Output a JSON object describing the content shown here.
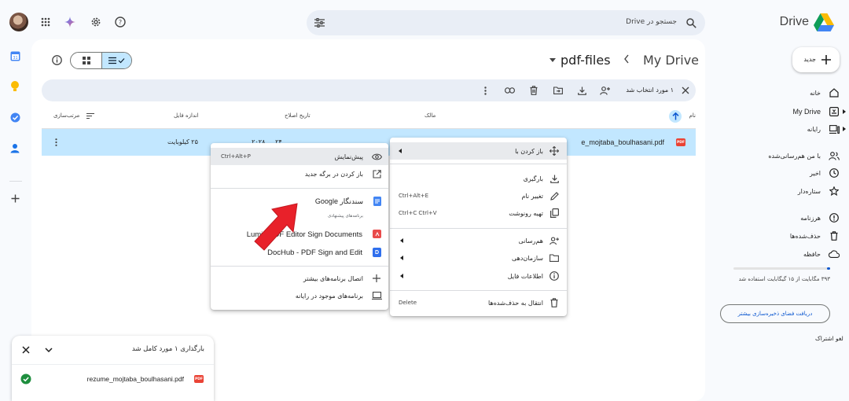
{
  "header": {
    "search_placeholder": "جستجو در Drive",
    "app_name": "Drive"
  },
  "breadcrumb": {
    "root": "My Drive",
    "folder": "pdf-files"
  },
  "selection_bar": {
    "count_label": "۱ مورد انتخاب شد"
  },
  "columns": {
    "name": "نام",
    "owner": "مالک",
    "modified": "تاریخ اصلاح",
    "size": "اندازه فایل",
    "sort": "مرتب‌سازی"
  },
  "file_row": {
    "name": "rezume_mojtaba_boulhasani.pdf",
    "name_visible": "e_mojtaba_boulhasani.pdf",
    "modified": "۲۴ ... ۲۰۲۸ ...",
    "size": "۲۵ کیلوبایت",
    "type_badge": "PDF"
  },
  "sidebar": {
    "new_button": "جدید",
    "items": [
      {
        "label": "خانه",
        "icon": "home-icon"
      },
      {
        "label": "My Drive",
        "icon": "my-drive-icon"
      },
      {
        "label": "رایانه",
        "icon": "computer-icon"
      },
      {
        "label": "با من هم‌رسانی‌شده",
        "icon": "shared-icon"
      },
      {
        "label": "اخیر",
        "icon": "clock-icon"
      },
      {
        "label": "ستاره‌دار",
        "icon": "star-icon"
      },
      {
        "label": "هرزنامه",
        "icon": "spam-icon"
      },
      {
        "label": "حذف‌شده‌ها",
        "icon": "trash-icon"
      },
      {
        "label": "حافظه",
        "icon": "cloud-icon"
      }
    ],
    "storage_text": "۳۹۳ مگابایت از ۱۵ گیگابایت استفاده شد",
    "storage_fraction": 0.03,
    "get_storage_button": "دریافت فضای ذخیره‌سازی بیشتر",
    "unsubscribe": "لغو اشتراک"
  },
  "context_menu": {
    "open_with": "باز کردن با",
    "download": "بارگیری",
    "rename": "تغییر نام",
    "rename_shortcut": "Ctrl+Alt+E",
    "copy": "تهیه رونوشت",
    "copy_shortcut": "Ctrl+C Ctrl+V",
    "share": "هم‌رسانی",
    "organize": "سازمان‌دهی",
    "file_info": "اطلاعات فایل",
    "move_to_trash": "انتقال به حذف‌شده‌ها",
    "trash_shortcut": "Delete"
  },
  "submenu": {
    "preview": "پیش‌نمایش",
    "preview_shortcut": "Ctrl+Alt+P",
    "open_new_tab": "باز کردن در برگه جدید",
    "google_docs": "سندنگار Google",
    "suggested_apps": "برنامه‌های پیشنهادی",
    "lumin": "Lumin PDF Editor Sign Documents",
    "dochub": "DocHub - PDF Sign and Edit",
    "connect_more": "اتصال برنامه‌های بیشتر",
    "computer_apps": "برنامه‌های موجود در رایانه"
  },
  "upload_toast": {
    "title": "بارگذاری ۱ مورد کامل شد",
    "file_name": "rezume_mojtaba_boulhasani.pdf",
    "badge": "PDF"
  },
  "colors": {
    "accent": "#0b57d0",
    "selected_row": "#c2e7ff",
    "pdf_red": "#ea4335",
    "arrow_red": "#e8212a",
    "success_green": "#1e8e3e"
  }
}
